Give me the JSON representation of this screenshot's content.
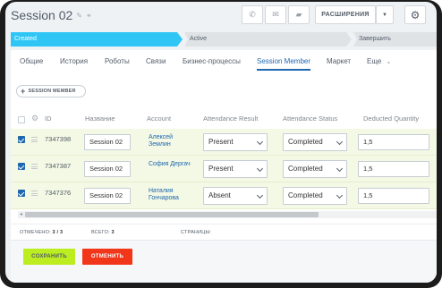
{
  "header": {
    "title": "Session 02",
    "extensions_label": "РАСШИРЕНИЯ"
  },
  "stages": {
    "created": "Created",
    "active": "Active",
    "close": "Завершить"
  },
  "tabs": [
    {
      "label": "Общие"
    },
    {
      "label": "История"
    },
    {
      "label": "Роботы"
    },
    {
      "label": "Связи"
    },
    {
      "label": "Бизнес-процессы"
    },
    {
      "label": "Session Member",
      "active": true
    },
    {
      "label": "Маркет"
    },
    {
      "label": "Еще"
    }
  ],
  "add_member_label": "SESSION MEMBER",
  "columns": {
    "id": "ID",
    "name": "Название",
    "account": "Account",
    "attendance_result": "Attendance Result",
    "attendance_status": "Attendance Status",
    "deducted_quantity": "Deducted Quantity"
  },
  "rows": [
    {
      "id": "7347398",
      "name": "Session 02",
      "account": "Алексей Землин",
      "result": "Present",
      "status": "Completed",
      "quantity": "1,5"
    },
    {
      "id": "7347387",
      "name": "Session 02",
      "account": "София Дергач",
      "result": "Present",
      "status": "Completed",
      "quantity": "1,5"
    },
    {
      "id": "7347376",
      "name": "Session 02",
      "account": "Наталия Гончарова",
      "result": "Absent",
      "status": "Completed",
      "quantity": "1,5"
    }
  ],
  "footer": {
    "selected_label": "ОТМЕЧЕНО:",
    "selected_value": "3 / 3",
    "total_label": "ВСЕГО:",
    "total_value": "3",
    "pages_label": "СТРАНИЦЫ:"
  },
  "buttons": {
    "save": "СОХРАНИТЬ",
    "cancel": "ОТМЕНИТЬ"
  },
  "colors": {
    "accent": "#2067b0",
    "stage_created": "#2fc6f6",
    "save": "#bbed21",
    "cancel": "#f1361a",
    "row_selected": "#f3f9e4"
  }
}
